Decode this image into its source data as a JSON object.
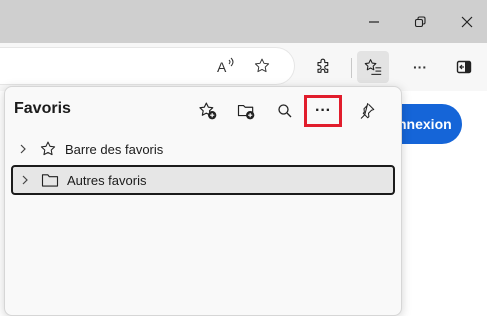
{
  "window": {
    "minimize_icon": "minimize-icon",
    "restore_icon": "restore-icon",
    "close_icon": "close-icon"
  },
  "toolbar": {
    "read_aloud_icon": "read-aloud-icon",
    "favorite_star_icon": "star-outline-icon",
    "extensions_icon": "puzzle-icon",
    "favorites_icon": "favorites-list-icon",
    "more_label": "···",
    "sidebar_icon": "sidebar-toggle-icon"
  },
  "page": {
    "connexion_label": "nnexion",
    "accent": "#1565d8"
  },
  "favorites_panel": {
    "title": "Favoris",
    "actions": {
      "add_favorite_icon": "star-add-icon",
      "add_folder_icon": "folder-add-icon",
      "search_icon": "search-icon",
      "more_label": "···",
      "pin_icon": "pin-icon"
    },
    "highlight_color": "#e11d2c",
    "items": [
      {
        "label": "Barre des favoris",
        "icon": "star-outline-icon",
        "selected": false
      },
      {
        "label": "Autres favoris",
        "icon": "folder-icon",
        "selected": true
      }
    ]
  }
}
